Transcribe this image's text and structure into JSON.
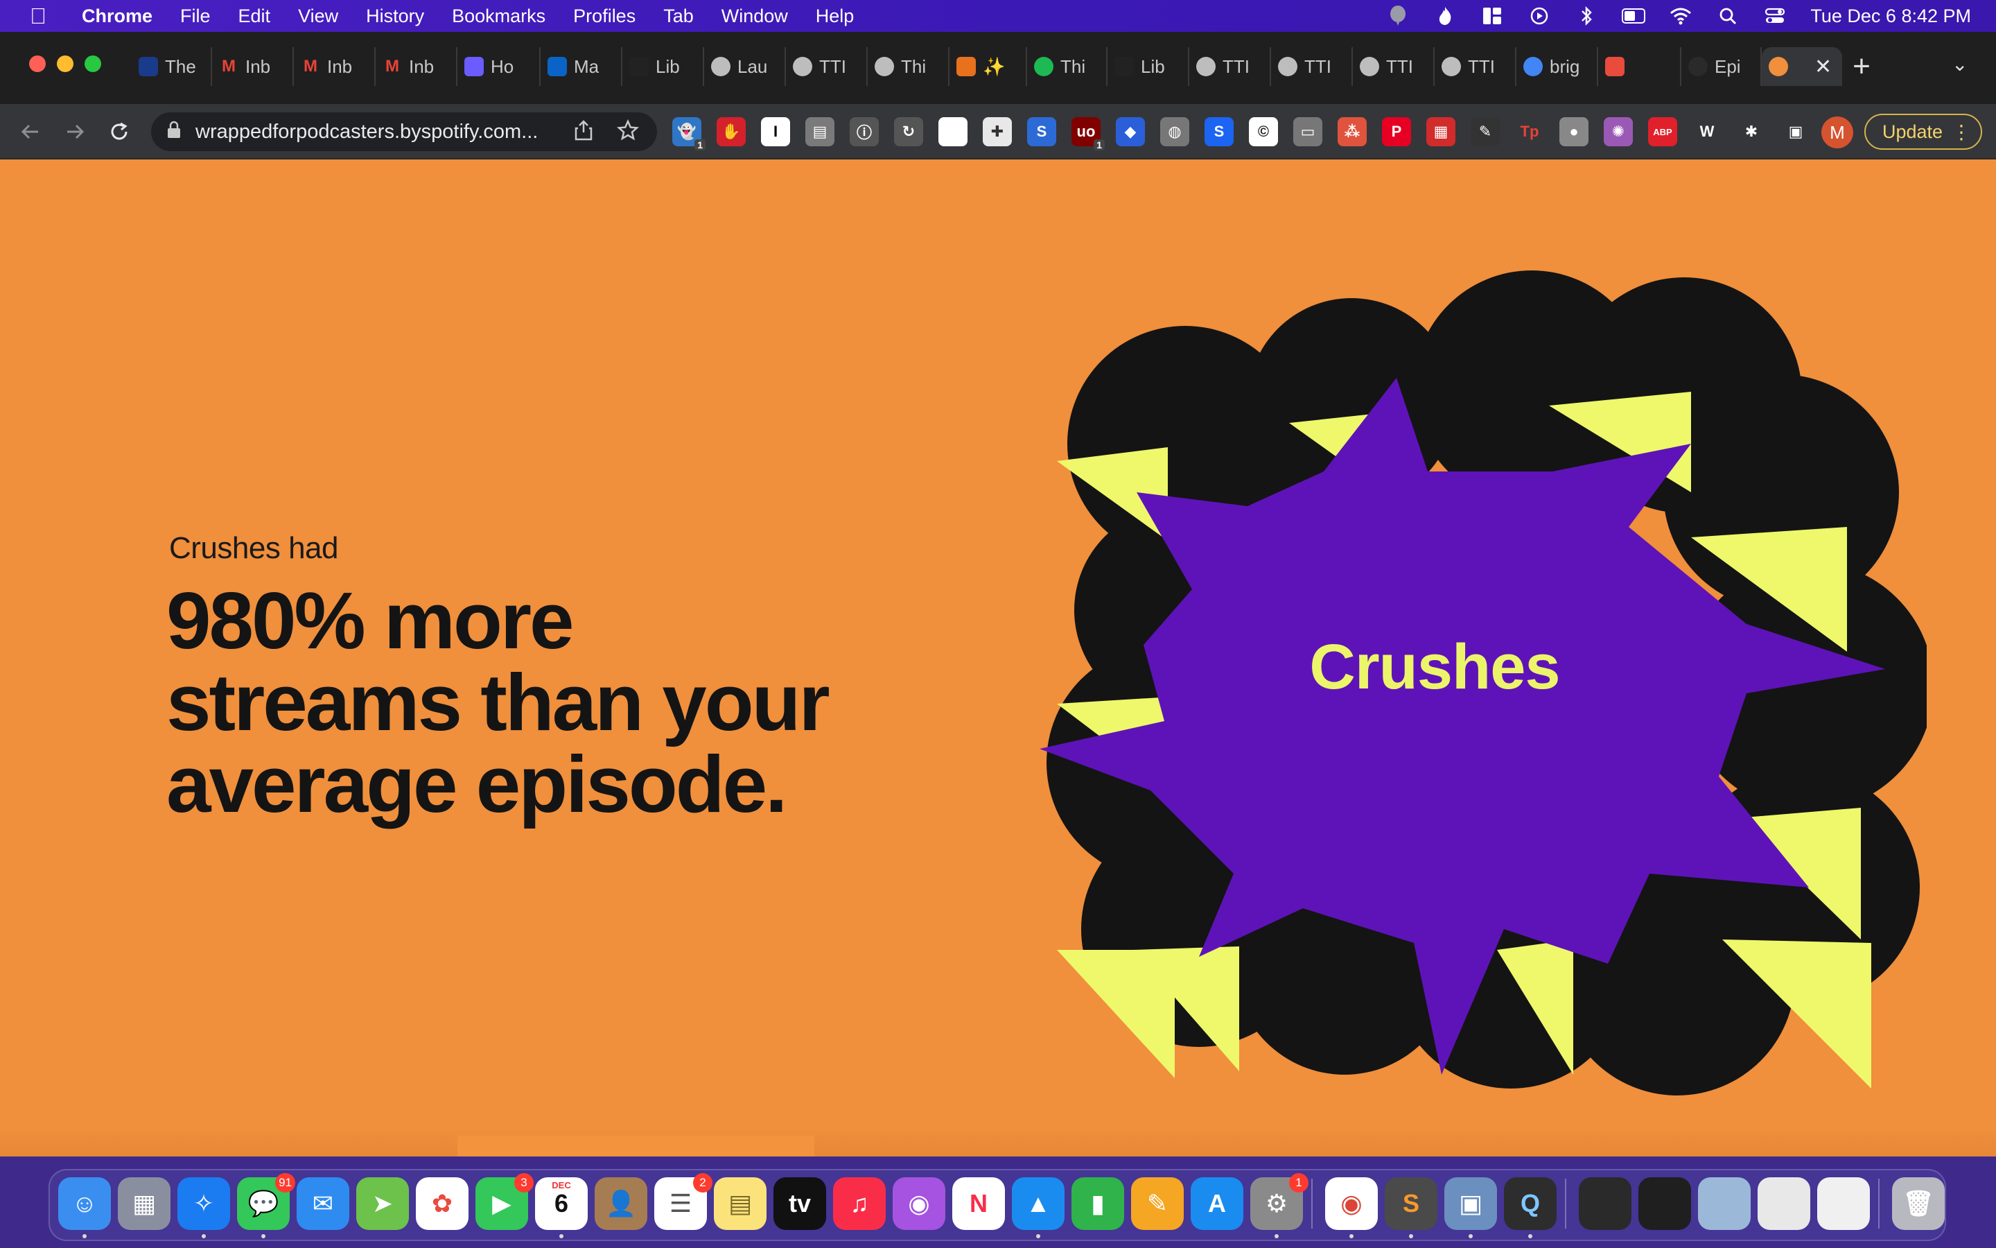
{
  "menubar": {
    "app_name": "Chrome",
    "menus": [
      "File",
      "Edit",
      "View",
      "History",
      "Bookmarks",
      "Profiles",
      "Tab",
      "Window",
      "Help"
    ],
    "clock": "Tue Dec 6  8:42 PM",
    "battery_level": 0.4
  },
  "browser": {
    "tabs": [
      {
        "label": "The",
        "icon": "news-icon",
        "color": "#1a3a8a"
      },
      {
        "label": "Inb",
        "icon": "gmail-icon",
        "color": "#d93025"
      },
      {
        "label": "Inb",
        "icon": "gmail-icon",
        "color": "#d93025"
      },
      {
        "label": "Inb",
        "icon": "gmail-icon",
        "color": "#d93025"
      },
      {
        "label": "Ho",
        "icon": "hexagon-icon",
        "color": "#6a5cff"
      },
      {
        "label": "Ma",
        "icon": "outlook-icon",
        "color": "#0a64c8"
      },
      {
        "label": "Lib",
        "icon": "dark-square-icon",
        "color": "#222222"
      },
      {
        "label": "Lau",
        "icon": "globe-icon",
        "color": "#5f6368"
      },
      {
        "label": "TTI",
        "icon": "globe-icon",
        "color": "#5f6368"
      },
      {
        "label": "Thi",
        "icon": "globe-icon",
        "color": "#5f6368"
      },
      {
        "label": "✨",
        "icon": "orange-badge-icon",
        "color": "#e8711e"
      },
      {
        "label": "Thi",
        "icon": "spotify-icon",
        "color": "#1db954"
      },
      {
        "label": "Lib",
        "icon": "dark-square-icon",
        "color": "#222222"
      },
      {
        "label": "TTI",
        "icon": "globe-icon",
        "color": "#5f6368"
      },
      {
        "label": "TTI",
        "icon": "globe-icon",
        "color": "#5f6368"
      },
      {
        "label": "TTI",
        "icon": "globe-icon",
        "color": "#5f6368"
      },
      {
        "label": "TTI",
        "icon": "globe-icon",
        "color": "#5f6368"
      },
      {
        "label": "brig",
        "icon": "google-icon",
        "color": "#4285f4"
      },
      {
        "label": "",
        "icon": "colorful-grid-icon",
        "color": "#e94b3c"
      },
      {
        "label": "Epi",
        "icon": "dark-circle-icon",
        "color": "#2a2a2a"
      },
      {
        "label": "",
        "icon": "spotify-orange-icon",
        "color": "#f08f3c",
        "active": true,
        "close": "✕"
      }
    ],
    "url": "wrappedforpodcasters.byspotify.com...",
    "update_label": "Update",
    "avatar_initial": "M",
    "extensions": [
      {
        "icon": "ghost-ext-icon",
        "color": "#2f76c6",
        "glyph": "👻",
        "badge": "1"
      },
      {
        "icon": "hand-ext-icon",
        "color": "#d4212b",
        "glyph": "✋"
      },
      {
        "icon": "instapaper-ext-icon",
        "color": "#ffffff",
        "glyph": "I",
        "text_color": "#000"
      },
      {
        "icon": "reader-ext-icon",
        "color": "#7a7a7a",
        "glyph": "▤"
      },
      {
        "icon": "info-ext-icon",
        "color": "#555555",
        "glyph": "ⓘ"
      },
      {
        "icon": "refresh-ext-icon",
        "color": "#555555",
        "glyph": "↻"
      },
      {
        "icon": "square-ext-icon",
        "color": "#ffffff",
        "glyph": "■",
        "text_color": "#fff"
      },
      {
        "icon": "plus-ext-icon",
        "color": "#e8e8e8",
        "glyph": "✚",
        "text_color": "#333"
      },
      {
        "icon": "s-ext-icon",
        "color": "#2c6bd6",
        "glyph": "S"
      },
      {
        "icon": "ublock-ext-icon",
        "color": "#800000",
        "glyph": "uo",
        "badge": "1"
      },
      {
        "icon": "diamond-ext-icon",
        "color": "#2b5fd9",
        "glyph": "◆"
      },
      {
        "icon": "globe-ext-icon",
        "color": "#777777",
        "glyph": "◍"
      },
      {
        "icon": "s-blue-ext-icon",
        "color": "#1c64f2",
        "glyph": "S"
      },
      {
        "icon": "c-ext-icon",
        "color": "#ffffff",
        "glyph": "©",
        "text_color": "#222"
      },
      {
        "icon": "chat-ext-icon",
        "color": "#777777",
        "glyph": "▭"
      },
      {
        "icon": "dots-ext-icon",
        "color": "#e0533c",
        "glyph": "⁂"
      },
      {
        "icon": "pinterest-ext-icon",
        "color": "#e60023",
        "glyph": "P"
      },
      {
        "icon": "chart-ext-icon",
        "color": "#d12b2b",
        "glyph": "▦"
      },
      {
        "icon": "pen-ext-icon",
        "color": "#333333",
        "glyph": "✎"
      },
      {
        "icon": "tp-ext-icon",
        "color": "#35363a",
        "glyph": "Tp",
        "text_color": "#e94235"
      },
      {
        "icon": "bubble-ext-icon",
        "color": "#888888",
        "glyph": "●"
      },
      {
        "icon": "color-wheel-ext-icon",
        "color": "#9b59b6",
        "glyph": "✺"
      },
      {
        "icon": "adblock-ext-icon",
        "color": "#e0202a",
        "glyph": "ABP"
      },
      {
        "icon": "wikipedia-ext-icon",
        "color": "#35363a",
        "glyph": "W"
      },
      {
        "icon": "puzzle-ext-icon",
        "color": "#35363a",
        "glyph": "✱"
      },
      {
        "icon": "sidepanel-ext-icon",
        "color": "#35363a",
        "glyph": "▣"
      }
    ]
  },
  "content": {
    "eyebrow": "Crushes had",
    "headline": "980% more streams than your average episode.",
    "art_label": "Crushes",
    "colors": {
      "background": "#f08f3c",
      "burst": "#5e13b8",
      "circles": "#141414",
      "triangles": "#eef86a",
      "text": "#141414"
    }
  },
  "dock": {
    "apps": [
      {
        "name": "finder-icon",
        "color": "#3a8ef0",
        "glyph": "☺",
        "running": true
      },
      {
        "name": "launchpad-icon",
        "color": "#8a8fa0",
        "glyph": "▦"
      },
      {
        "name": "safari-icon",
        "color": "#1a7cf0",
        "glyph": "✧",
        "running": true
      },
      {
        "name": "messages-icon",
        "color": "#34c759",
        "glyph": "💬",
        "badge": "91",
        "running": true
      },
      {
        "name": "mail-icon",
        "color": "#2e8cf0",
        "glyph": "✉"
      },
      {
        "name": "maps-icon",
        "color": "#6cc24a",
        "glyph": "➤"
      },
      {
        "name": "photos-icon",
        "color": "#ffffff",
        "glyph": "✿",
        "text_color": "#e94b3c"
      },
      {
        "name": "facetime-icon",
        "color": "#34c759",
        "glyph": "▶",
        "badge": "3"
      },
      {
        "name": "calendar-icon",
        "color": "#ffffff",
        "glyph": "6",
        "text_color": "#111",
        "month": "DEC",
        "running": true
      },
      {
        "name": "contacts-icon",
        "color": "#a67c52",
        "glyph": "👤"
      },
      {
        "name": "reminders-icon",
        "color": "#ffffff",
        "glyph": "☰",
        "text_color": "#555",
        "badge": "2"
      },
      {
        "name": "notes-icon",
        "color": "#fbe27a",
        "glyph": "▤",
        "text_color": "#7a6a2a"
      },
      {
        "name": "appletv-icon",
        "color": "#111111",
        "glyph": "tv"
      },
      {
        "name": "music-icon",
        "color": "#fa2d48",
        "glyph": "♫"
      },
      {
        "name": "podcasts-icon",
        "color": "#a553e0",
        "glyph": "◉"
      },
      {
        "name": "news-icon",
        "color": "#ffffff",
        "glyph": "N",
        "text_color": "#fa2d48"
      },
      {
        "name": "keynote-icon",
        "color": "#1a8cf0",
        "glyph": "▲",
        "running": true
      },
      {
        "name": "numbers-icon",
        "color": "#2fb34a",
        "glyph": "▮"
      },
      {
        "name": "pages-icon",
        "color": "#f5a623",
        "glyph": "✎"
      },
      {
        "name": "appstore-icon",
        "color": "#1a8cf0",
        "glyph": "A"
      },
      {
        "name": "systemprefs-icon",
        "color": "#8a8a8a",
        "glyph": "⚙",
        "badge": "1",
        "running": true
      },
      {
        "name": "chrome-icon",
        "color": "#ffffff",
        "glyph": "◉",
        "text_color": "#db4437",
        "running": true
      },
      {
        "name": "sublime-icon",
        "color": "#4a4a4a",
        "glyph": "S",
        "text_color": "#f79a2b",
        "running": true
      },
      {
        "name": "preview-icon",
        "color": "#6b8fbf",
        "glyph": "▣",
        "running": true
      },
      {
        "name": "quicktime-icon",
        "color": "#2d2d2d",
        "glyph": "Q",
        "text_color": "#7fc7ff",
        "running": true
      },
      {
        "name": "minimized-window-1-icon",
        "color": "#2a2a2a",
        "glyph": ""
      },
      {
        "name": "minimized-window-2-icon",
        "color": "#1f1f1f",
        "glyph": ""
      },
      {
        "name": "minimized-window-3-icon",
        "color": "#9bb8d8",
        "glyph": ""
      },
      {
        "name": "minimized-window-4-icon",
        "color": "#e8e8e8",
        "glyph": ""
      },
      {
        "name": "minimized-window-5-icon",
        "color": "#f0f0f0",
        "glyph": ""
      },
      {
        "name": "trash-icon",
        "color": "#b8b8c0",
        "glyph": "🗑"
      }
    ]
  }
}
